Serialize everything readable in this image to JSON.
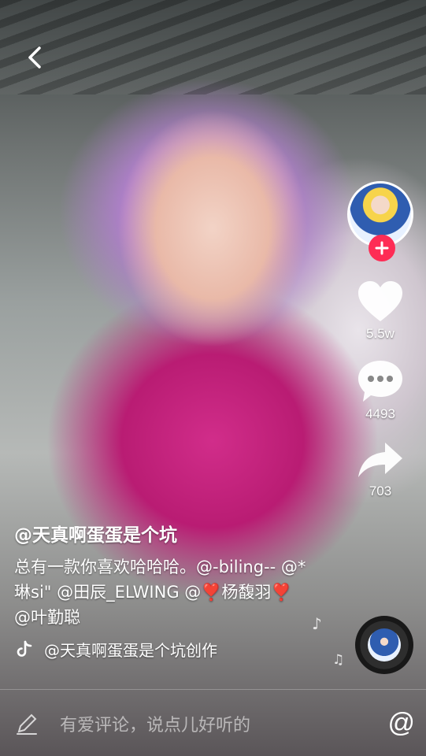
{
  "sidebar": {
    "likes": "5.5w",
    "comments": "4493",
    "shares": "703"
  },
  "caption": {
    "author": "@天真啊蛋蛋是个坑",
    "description": "总有一款你喜欢哈哈哈。@-biling-- @*琳si\" @田辰_ELWING @❣️杨馥羽❣️ @叶勤聪",
    "music": "@天真啊蛋蛋是个坑创作"
  },
  "footer": {
    "comment_placeholder": "有爱评论，说点儿好听的",
    "at_symbol": "@"
  },
  "colors": {
    "accent": "#fe2c55",
    "text": "#ffffff"
  }
}
